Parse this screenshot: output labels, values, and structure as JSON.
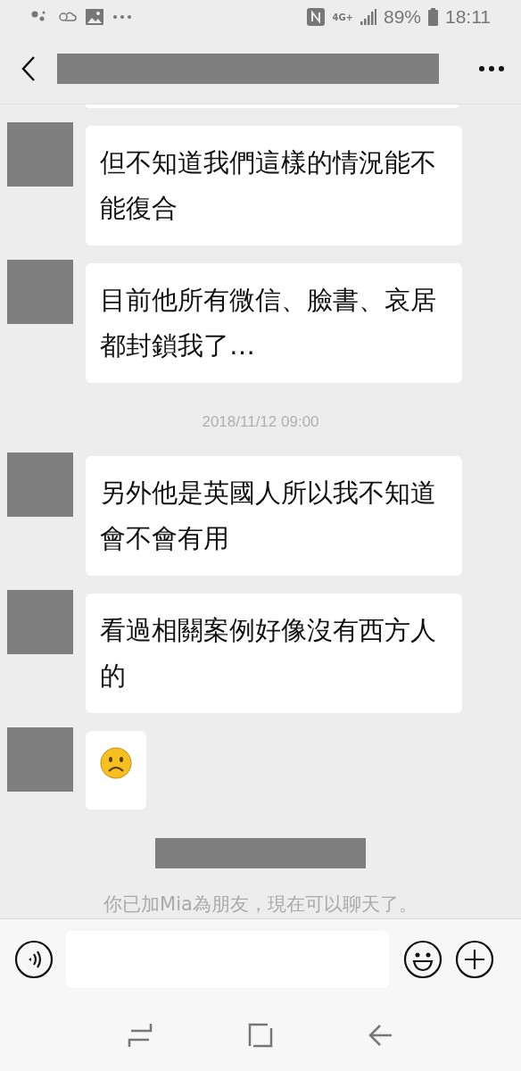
{
  "status_bar": {
    "network": "4G+",
    "battery": "89%",
    "time": "18:11"
  },
  "messages": [
    {
      "kind": "text",
      "text": "但不知道我們這樣的情況能不能復合"
    },
    {
      "kind": "text",
      "text": "目前他所有微信、臉書、哀居都封鎖我了…"
    },
    {
      "kind": "time",
      "text": "2018/11/12 09:00"
    },
    {
      "kind": "text",
      "text": "另外他是英國人所以我不知道會不會有用"
    },
    {
      "kind": "text",
      "text": "看過相關案例好像沒有西方人的"
    },
    {
      "kind": "frown"
    },
    {
      "kind": "hidden"
    },
    {
      "kind": "system",
      "text": "你已加Mia為朋友，現在可以聊天了。"
    }
  ]
}
